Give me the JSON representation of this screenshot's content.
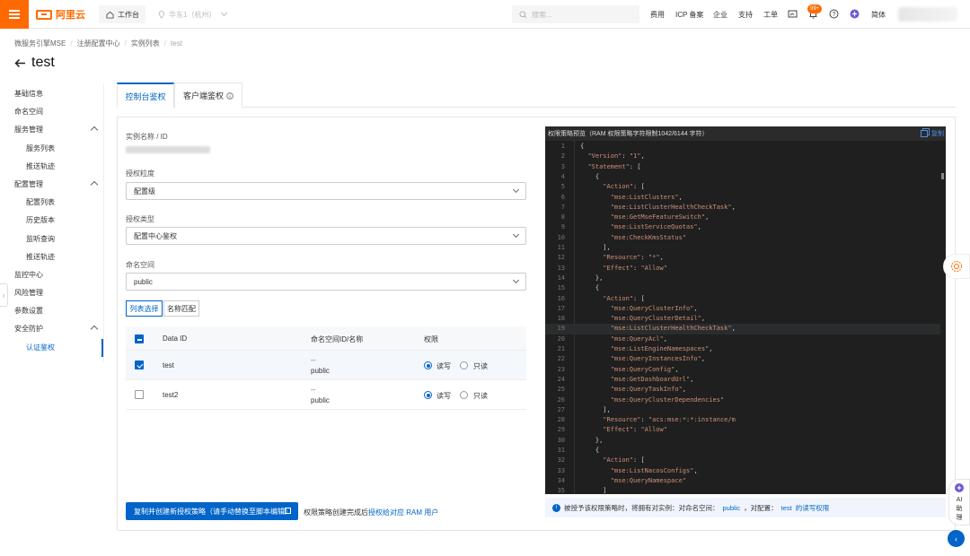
{
  "topbar": {
    "logo": "阿里云",
    "workbench": "工作台",
    "region": "华东1（杭州）",
    "search_placeholder": "搜索...",
    "links": [
      "费用",
      "ICP 备案",
      "企业",
      "支持",
      "工单"
    ],
    "notification_badge": "99+",
    "lang": "简体"
  },
  "breadcrumb": [
    "微服务引擎MSE",
    "注册配置中心",
    "实例列表",
    "test"
  ],
  "page_title": "test",
  "sidebar": {
    "items": [
      {
        "label": "基础信息",
        "level": 1
      },
      {
        "label": "命名空间",
        "level": 1
      },
      {
        "label": "服务管理",
        "level": 1,
        "expanded": true
      },
      {
        "label": "服务列表",
        "level": 2
      },
      {
        "label": "推送轨迹",
        "level": 2
      },
      {
        "label": "配置管理",
        "level": 1,
        "expanded": true
      },
      {
        "label": "配置列表",
        "level": 2
      },
      {
        "label": "历史版本",
        "level": 2
      },
      {
        "label": "监听查询",
        "level": 2
      },
      {
        "label": "推送轨迹",
        "level": 2
      },
      {
        "label": "监控中心",
        "level": 1
      },
      {
        "label": "风险管理",
        "level": 1
      },
      {
        "label": "参数设置",
        "level": 1
      },
      {
        "label": "安全防护",
        "level": 1,
        "expanded": true
      },
      {
        "label": "认证鉴权",
        "level": 2,
        "active": true
      }
    ]
  },
  "tabs": [
    {
      "label": "控制台鉴权",
      "active": true
    },
    {
      "label": "客户端鉴权",
      "active": false
    }
  ],
  "form": {
    "instance_label": "实例名称 / ID",
    "granularity_label": "授权粒度",
    "granularity_value": "配置级",
    "type_label": "授权类型",
    "type_value": "配置中心鉴权",
    "namespace_label": "命名空间",
    "namespace_value": "public",
    "seg_list": "列表选择",
    "seg_match": "名称匹配"
  },
  "table": {
    "headers": [
      "Data ID",
      "命名空间ID/名称",
      "权限"
    ],
    "rows": [
      {
        "data_id": "test",
        "ns_id": "--",
        "ns_name": "public",
        "checked": true,
        "perm": "读写"
      },
      {
        "data_id": "test2",
        "ns_id": "--",
        "ns_name": "public",
        "checked": false,
        "perm": "读写"
      }
    ],
    "perm_rw": "读写",
    "perm_ro": "只读"
  },
  "primary_button": "复制并创建新授权策略（请手动替换至脚本编辑）",
  "after_button_text": "权限策略创建完成后",
  "after_button_link": "授权给对应 RAM 用户",
  "code": {
    "header": "权限策略预览（RAM 权限策略字符限制1042/6144 字符）",
    "copy": "复制",
    "lines": [
      "{",
      "  \"Version\": \"1\",",
      "  \"Statement\": [",
      "    {",
      "      \"Action\": [",
      "        \"mse:ListClusters\",",
      "        \"mse:ListClusterHealthCheckTask\",",
      "        \"mse:GetMseFeatureSwitch\",",
      "        \"mse:ListServiceQuotas\",",
      "        \"mse:CheckKmsStatus\"",
      "      ],",
      "      \"Resource\": \"*\",",
      "      \"Effect\": \"Allow\"",
      "    },",
      "    {",
      "      \"Action\": [",
      "        \"mse:QueryClusterInfo\",",
      "        \"mse:QueryClusterDetail\",",
      "        \"mse:ListClusterHealthCheckTask\",",
      "        \"mse:QueryAcl\",",
      "        \"mse:ListEngineNamespaces\",",
      "        \"mse:QueryInstancesInfo\",",
      "        \"mse:QueryConfig\",",
      "        \"mse:GetDashboardUrl\",",
      "        \"mse:QueryTaskInfo\",",
      "        \"mse:QueryClusterDependencies\"",
      "      ],",
      "      \"Resource\": \"acs:mse:*:*:instance/m",
      "      \"Effect\": \"Allow\"",
      "    },",
      "    {",
      "      \"Action\": [",
      "        \"mse:ListNacosConfigs\",",
      "        \"mse:QueryNamespace\"",
      "      ]"
    ]
  },
  "footer_note": {
    "prefix": "被授予该权限策略时，将拥有对实例：对命名空间：",
    "ns": "public",
    "mid": "，对配置：",
    "cfg": "test",
    "suffix": "的读写权限"
  },
  "ai_helper": [
    "AI",
    "助",
    "理"
  ],
  "colors": {
    "brand": "#ff6a00",
    "primary": "#0064c8"
  }
}
